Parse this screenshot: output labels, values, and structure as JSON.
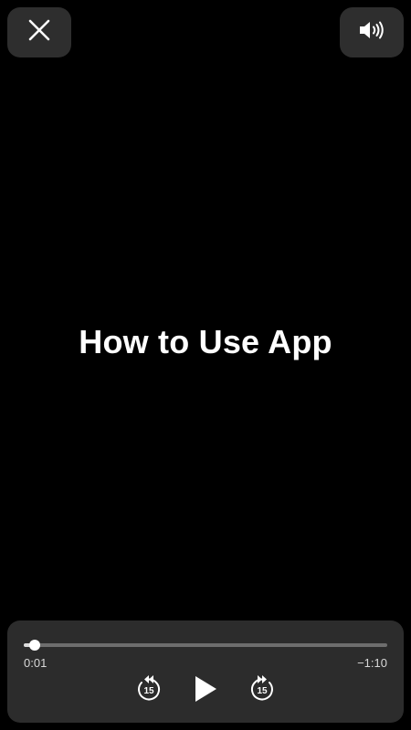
{
  "title": "How to Use App",
  "player": {
    "elapsed": "0:01",
    "remaining": "−1:10",
    "progress_fraction": 0.03,
    "skip_seconds": "15"
  },
  "icons": {
    "close": "close-icon",
    "volume": "speaker-volume-icon",
    "skip_back": "skip-back-15-icon",
    "play": "play-icon",
    "skip_forward": "skip-forward-15-icon"
  },
  "colors": {
    "background": "#000000",
    "panel": "#2c2c2c",
    "button": "#2e2e2e",
    "track": "#6e6e6e",
    "text": "#ffffff"
  }
}
